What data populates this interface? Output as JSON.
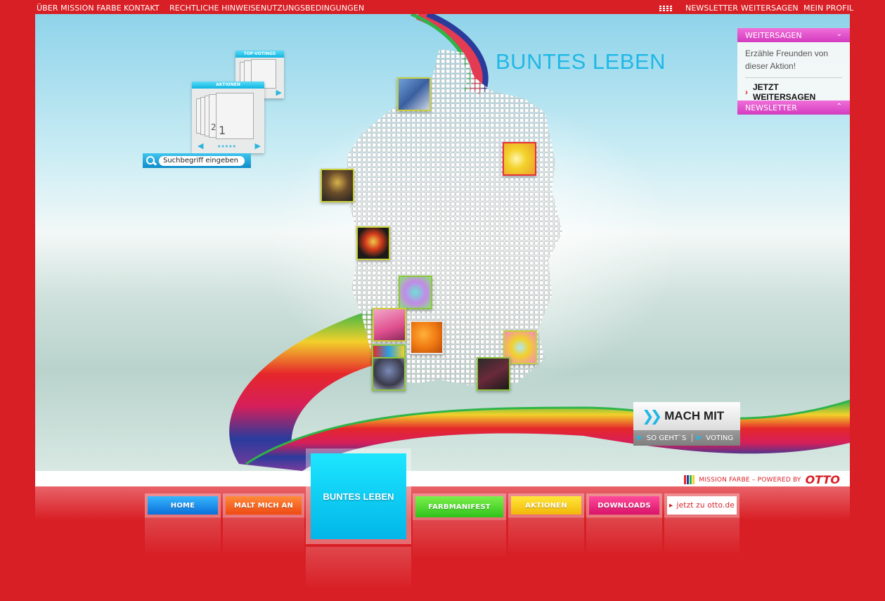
{
  "top_nav": {
    "left_links": [
      "ÜBER MISSION FARBE",
      "KONTAKT",
      "RECHTLICHE HINWEISE",
      "NUTZUNGSBEDINGUNGEN"
    ],
    "right_links": [
      "NEWSLETTER",
      "WEITERSAGEN",
      "MEIN PROFIL"
    ],
    "icon": "bar-chart-icon"
  },
  "hero": {
    "title": "BUNTES LEBEN"
  },
  "widgets": {
    "top_votings_label": "TOP-VOTINGS",
    "aktionen_label": "AKTIONEN",
    "aktionen_numbers": [
      "2",
      "1"
    ],
    "stars": "★★★★★"
  },
  "search": {
    "placeholder": "Suchbegriff eingeben"
  },
  "right_panel": {
    "weitersagen_title": "WEITERSAGEN",
    "weitersagen_text": "Erzähle Freunden von dieser Aktion!",
    "weitersagen_link": "JETZT WEITERSAGEN",
    "newsletter_title": "NEWSLETTER"
  },
  "mach_mit": {
    "label": "MACH MIT",
    "so_gehts": "SO GEHT`S",
    "voting": "VOTING"
  },
  "powered_by": {
    "text": "MISSION FARBE – POWERED BY",
    "brand": "OTTO"
  },
  "bottom_nav": {
    "home": "HOME",
    "malt_mich_an": "MALT MICH AN",
    "buntes_leben": "BUNTES LEBEN",
    "farbmanifest": "FARBMANIFEST",
    "aktionen": "AKTIONEN",
    "downloads": "DOWNLOADS",
    "otto_link": "jetzt zu otto.de"
  },
  "colors": {
    "brand_red": "#d81f25",
    "accent_cyan": "#1fb8e6",
    "panel_pink": "#e04ccb"
  }
}
